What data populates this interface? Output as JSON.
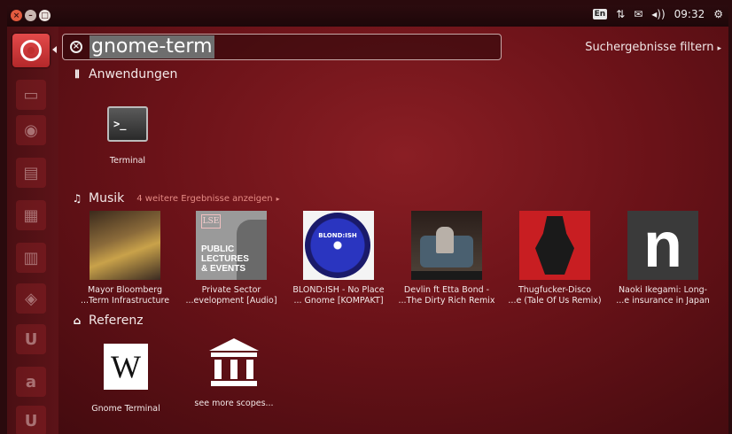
{
  "panel": {
    "keyboard": "En",
    "time": "09:32"
  },
  "search": {
    "query": "gnome-term",
    "filter_label": "Suchergebnisse filtern"
  },
  "launcher": {
    "items": [
      "dash",
      "files",
      "firefox",
      "writer",
      "calc",
      "impress",
      "software",
      "settings",
      "ubuntu-one",
      "amazon",
      "ubuntu-one-2"
    ]
  },
  "sections": {
    "apps": {
      "title": "Anwendungen",
      "items": [
        {
          "label": "Terminal"
        }
      ]
    },
    "music": {
      "title": "Musik",
      "more_label": "4 weitere Ergebnisse anzeigen",
      "items": [
        {
          "line1": "Mayor Bloomberg",
          "line2": "...Term Infrastructure"
        },
        {
          "line1": "Private Sector",
          "line2": "...evelopment [Audio]"
        },
        {
          "line1": "BLOND:ISH - No Place",
          "line2": "... Gnome [KOMPAKT]"
        },
        {
          "line1": "Devlin ft Etta Bond -",
          "line2": "...The Dirty Rich Remix"
        },
        {
          "line1": "Thugfucker-Disco",
          "line2": "...e (Tale Of Us Remix)"
        },
        {
          "line1": "Naoki Ikegami: Long-",
          "line2": "...e insurance in Japan"
        }
      ],
      "album_text": {
        "lse": "LSE",
        "public": "PUBLIC",
        "lectures": "LECTURES",
        "events": "& EVENTS",
        "blondish": "BLOND:ISH",
        "n": "n"
      }
    },
    "reference": {
      "title": "Referenz",
      "items": [
        {
          "label": "Gnome Terminal",
          "glyph": "W"
        },
        {
          "label": "see more scopes..."
        }
      ]
    }
  }
}
